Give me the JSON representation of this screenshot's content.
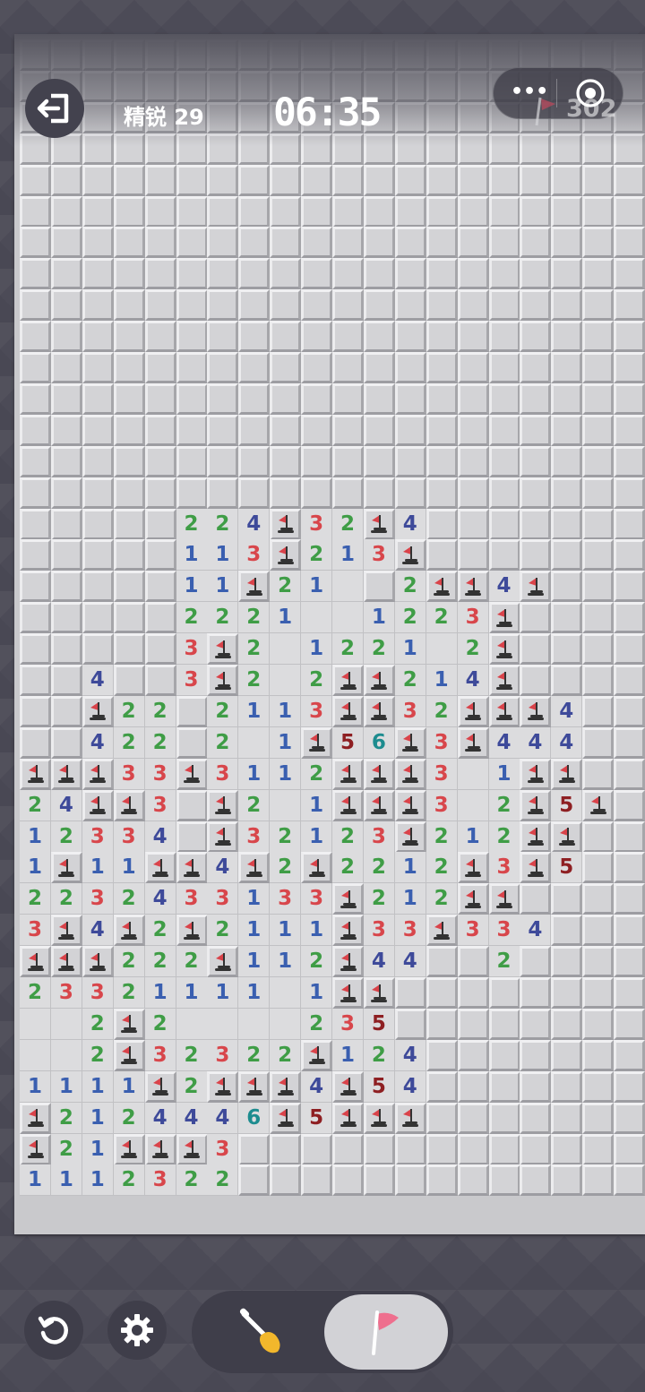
{
  "header": {
    "difficulty": "精锐 29",
    "timer": "06:35",
    "mines_remaining": "302"
  },
  "controls": {
    "exit": "exit-icon",
    "more": "•••",
    "target": "target-icon",
    "restart": "restart-icon",
    "settings": "gear-icon",
    "dig_mode": "shovel-icon",
    "flag_mode": "flag-icon",
    "active_mode": "flag"
  },
  "colors": {
    "n1": "#3a5fb0",
    "n2": "#3f9d46",
    "n3": "#d8464b",
    "n4": "#3e4a9a",
    "n5": "#8e1f22",
    "n6": "#1d8c8f",
    "flag": "#d9434a",
    "background": "#4c4b57"
  },
  "legend": {
    "#": "covered",
    "F": "flag",
    "0": "empty",
    "1-8": "number"
  },
  "board": {
    "cols": 20,
    "rows": [
      "####################",
      "####################",
      "####################",
      "####################",
      "####################",
      "####################",
      "####################",
      "####################",
      "####################",
      "####################",
      "####################",
      "####################",
      "####################",
      "####################",
      "####################",
      "#####224F32F4#######",
      "#####113F213F#######",
      "#####11F210#2FF4F###",
      "#####2221001223F####",
      "#####3F20122102F####",
      "##4##3F202FF214F####",
      "##F22#2113FF32FFF4##",
      "##422#201F56F3F444##",
      "FFF33F3112FFF301FF##",
      "24FF3#F201FFF302F5F#",
      "12334#F32123F212FF##",
      "1F11FF4F2F2212F3F5##",
      "2232433133F212FF####",
      "3F4F2F2111F33F334###",
      "FFF222F112F44##2####",
      "2332111101FF########",
      "002F20000235########",
      "002F32322F124#######",
      "1111F2FFF4F54#######",
      "F2124446F5FFF#######",
      "F21FFF3#############",
      "1112322#############"
    ]
  }
}
